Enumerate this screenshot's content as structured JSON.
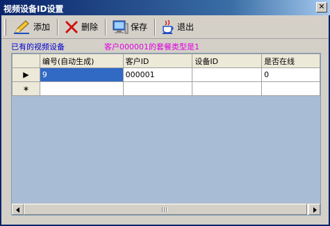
{
  "window": {
    "title": "视频设备ID设置",
    "close_glyph": "✕"
  },
  "toolbar": {
    "add_label": "添加",
    "delete_label": "删除",
    "save_label": "保存",
    "exit_label": "退出"
  },
  "labels": {
    "existing_devices": "已有的视频设备",
    "package_info": "客户000001的套餐类型是1"
  },
  "grid": {
    "columns": [
      "编号(自动生成)",
      "客户ID",
      "设备ID",
      "是否在线"
    ],
    "rows": [
      {
        "indicator": "▶",
        "cells": [
          "9",
          "000001",
          "",
          "0"
        ]
      },
      {
        "indicator": "∗",
        "cells": [
          "",
          "",
          "",
          ""
        ]
      }
    ]
  },
  "colors": {
    "title_bar": "#0a246a",
    "package_label": "#e000e0",
    "existing_label": "#0000cc",
    "selection": "#316ac5"
  }
}
